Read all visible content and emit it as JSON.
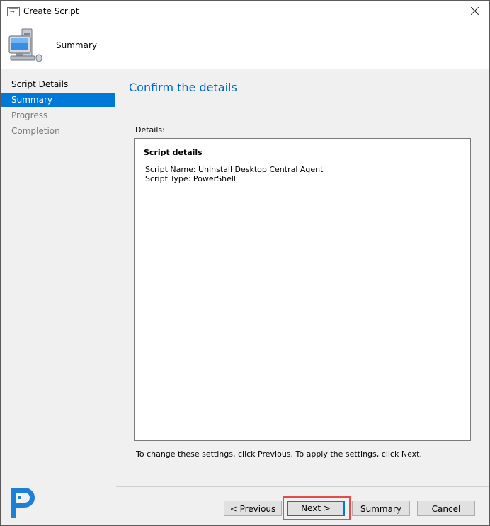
{
  "window": {
    "title": "Create Script"
  },
  "header": {
    "title": "Summary"
  },
  "nav": {
    "items": [
      {
        "label": "Script Details",
        "state": "normal"
      },
      {
        "label": "Summary",
        "state": "active"
      },
      {
        "label": "Progress",
        "state": "disabled"
      },
      {
        "label": "Completion",
        "state": "disabled"
      }
    ]
  },
  "main": {
    "heading": "Confirm the details",
    "details_label": "Details:",
    "box": {
      "heading": "Script details",
      "lines": [
        "Script Name: Uninstall Desktop Central Agent",
        "Script Type: PowerShell"
      ]
    },
    "footer_note": "To change these settings, click Previous. To apply the settings, click Next."
  },
  "buttons": {
    "previous": "< Previous",
    "next": "Next >",
    "summary": "Summary",
    "cancel": "Cancel"
  },
  "colors": {
    "accent": "#0078d7",
    "heading": "#0066cc",
    "highlight": "#e8494a",
    "logo": "#1e7fd6"
  },
  "icons": {
    "title": "script-window-icon",
    "header": "computer-icon",
    "close": "close-icon",
    "brand": "brand-logo-icon"
  }
}
